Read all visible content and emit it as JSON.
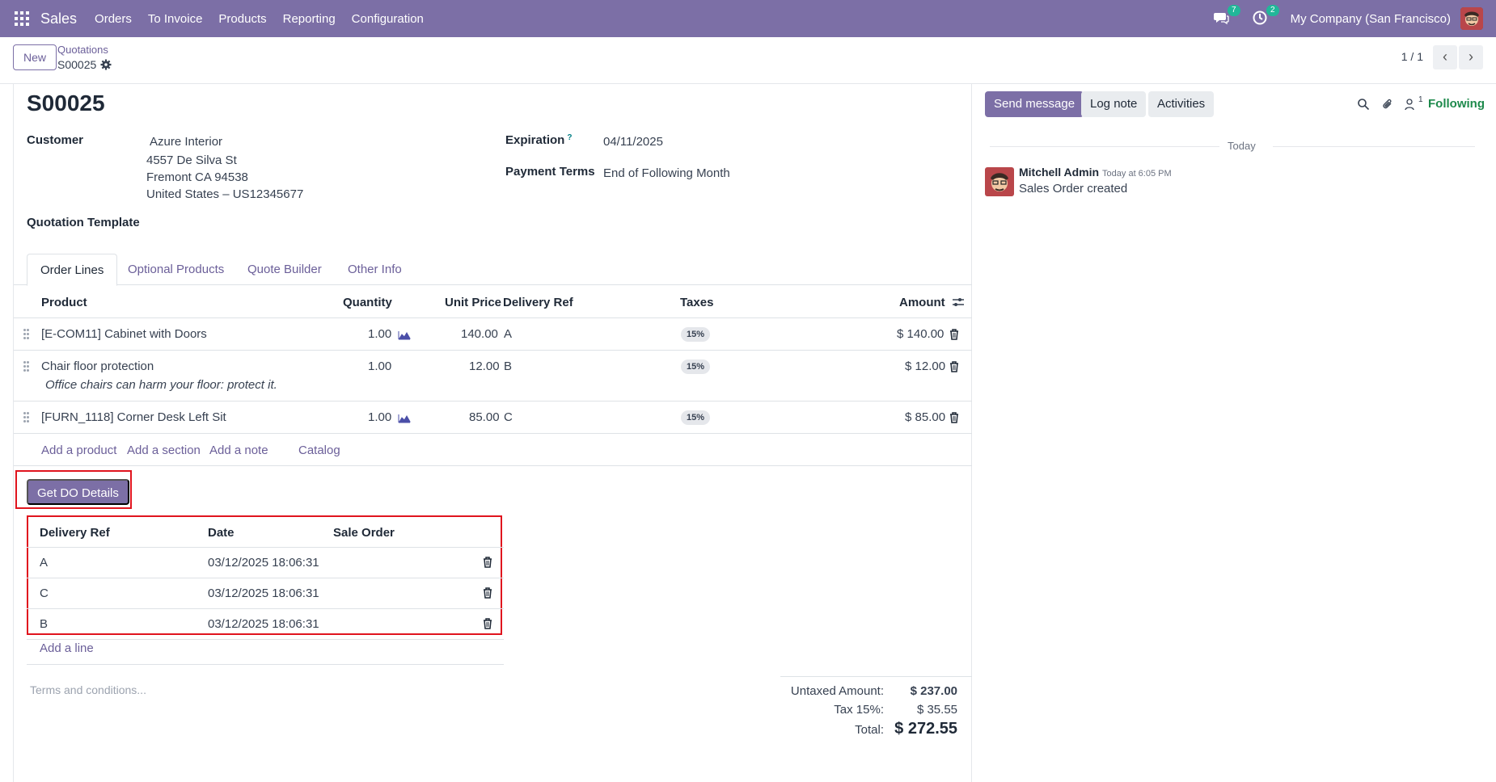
{
  "navbar": {
    "app_name": "Sales",
    "menu": [
      "Orders",
      "To Invoice",
      "Products",
      "Reporting",
      "Configuration"
    ],
    "messages_count": "7",
    "activities_count": "2",
    "company": "My Company (San Francisco)"
  },
  "control": {
    "new_label": "New",
    "breadcrumb_parent": "Quotations",
    "breadcrumb_current": "S00025",
    "pager": "1 / 1"
  },
  "form": {
    "title": "S00025",
    "customer_label": "Customer",
    "customer_name": "Azure Interior",
    "customer_address": [
      "4557 De Silva St",
      "Fremont CA 94538",
      "United States – US12345677"
    ],
    "expiration_label": "Expiration",
    "expiration_help": "?",
    "expiration_value": "04/11/2025",
    "payment_terms_label": "Payment Terms",
    "payment_terms_value": "End of Following Month",
    "quotation_template_label": "Quotation Template"
  },
  "tabs": [
    "Order Lines",
    "Optional Products",
    "Quote Builder",
    "Other Info"
  ],
  "order_lines": {
    "headers": {
      "product": "Product",
      "quantity": "Quantity",
      "unit_price": "Unit Price",
      "delivery_ref": "Delivery Ref",
      "taxes": "Taxes",
      "amount": "Amount"
    },
    "rows": [
      {
        "product": "[E-COM11] Cabinet with Doors",
        "quantity": "1.00",
        "unit_price": "140.00",
        "delivery_ref": "A",
        "tax": "15%",
        "amount": "$ 140.00",
        "note": ""
      },
      {
        "product": "Chair floor protection",
        "quantity": "1.00",
        "unit_price": "12.00",
        "delivery_ref": "B",
        "tax": "15%",
        "amount": "$ 12.00",
        "note": "Office chairs can harm your floor: protect it."
      },
      {
        "product": "[FURN_1118] Corner Desk Left Sit",
        "quantity": "1.00",
        "unit_price": "85.00",
        "delivery_ref": "C",
        "tax": "15%",
        "amount": "$ 85.00",
        "note": ""
      }
    ],
    "add_links": [
      "Add a product",
      "Add a section",
      "Add a note",
      "Catalog"
    ]
  },
  "get_do_button": "Get DO Details",
  "do_table": {
    "headers": {
      "delivery_ref": "Delivery Ref",
      "date": "Date",
      "sale_order": "Sale Order"
    },
    "rows": [
      {
        "delivery_ref": "A",
        "date": "03/12/2025 18:06:31",
        "sale_order": ""
      },
      {
        "delivery_ref": "C",
        "date": "03/12/2025 18:06:31",
        "sale_order": ""
      },
      {
        "delivery_ref": "B",
        "date": "03/12/2025 18:06:31",
        "sale_order": ""
      }
    ],
    "add_line": "Add a line"
  },
  "terms_placeholder": "Terms and conditions...",
  "totals": {
    "untaxed_label": "Untaxed Amount:",
    "untaxed_value": "$ 237.00",
    "tax_label": "Tax 15%:",
    "tax_value": "$ 35.55",
    "total_label": "Total:",
    "total_value": "$ 272.55"
  },
  "chatter": {
    "send_message": "Send message",
    "log_note": "Log note",
    "activities": "Activities",
    "followers_count": "1",
    "following": "Following",
    "date_separator": "Today",
    "message": {
      "author": "Mitchell Admin",
      "time": "Today at 6:05 PM",
      "body": "Sales Order created"
    }
  },
  "colors": {
    "brand": "#7c6fa6",
    "link": "#6b5f99",
    "highlight": "#e0141e",
    "following": "#1e8a4c"
  }
}
